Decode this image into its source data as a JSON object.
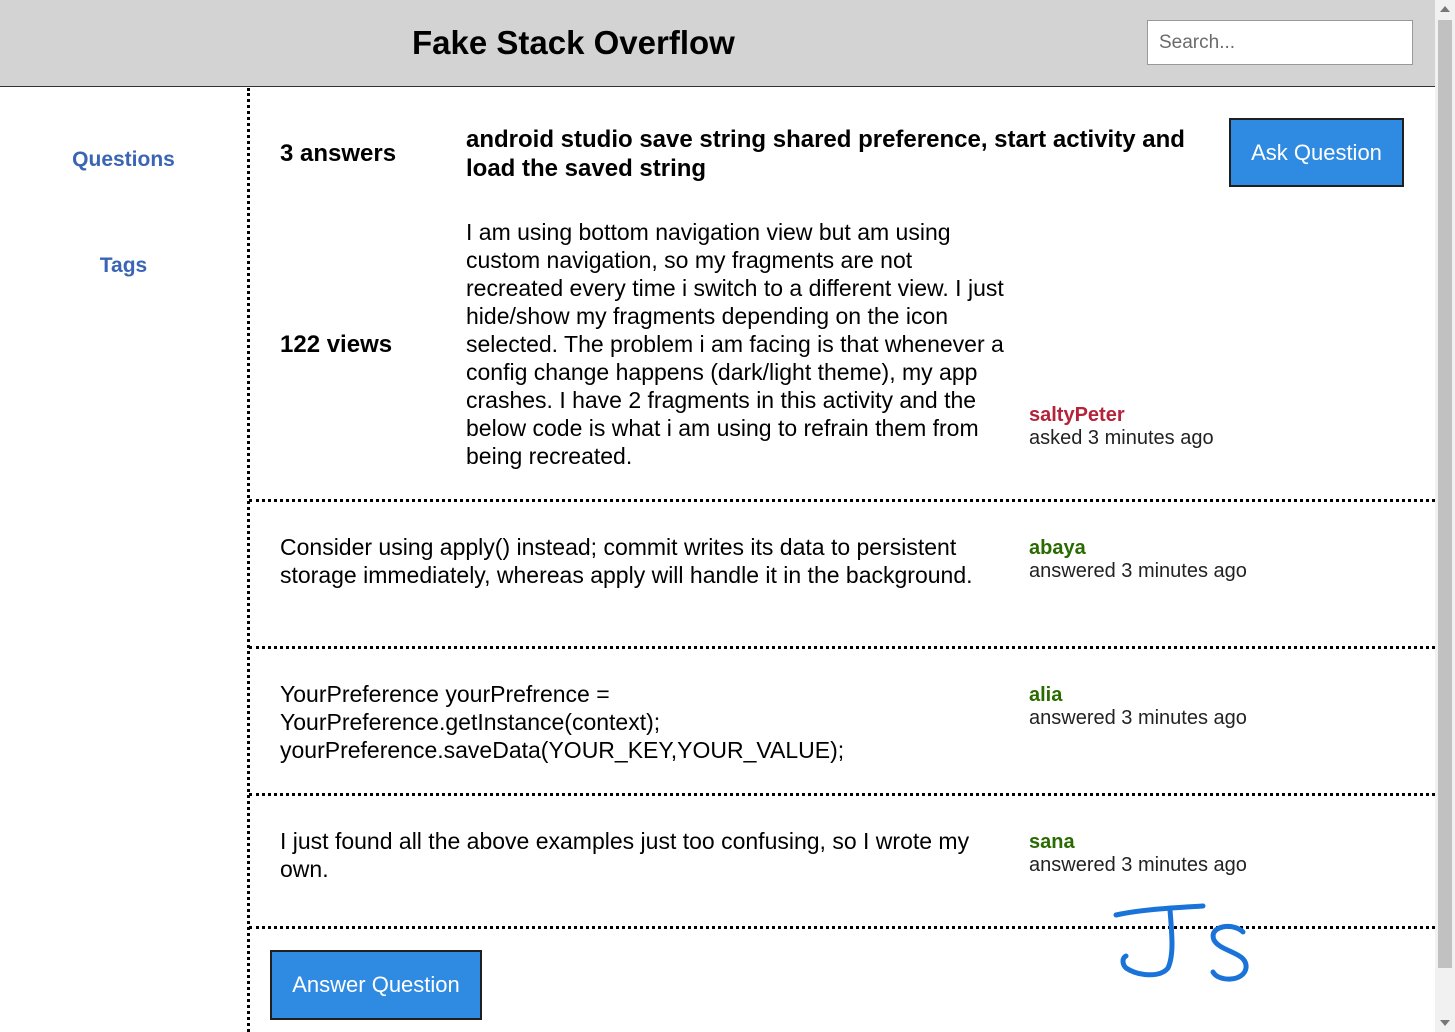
{
  "header": {
    "title": "Fake Stack Overflow",
    "search_placeholder": "Search..."
  },
  "sidebar": {
    "items": [
      {
        "label": "Questions"
      },
      {
        "label": "Tags"
      }
    ]
  },
  "question": {
    "answers_count": "3 answers",
    "views": "122 views",
    "title": "android studio save string shared preference, start activity and load the saved string",
    "text": "I am using bottom navigation view but am using custom navigation, so my fragments are not recreated every time i switch to a different view. I just hide/show my fragments depending on the icon selected. The problem i am facing is that whenever a config change happens (dark/light theme), my app crashes. I have 2 fragments in this activity and the below code is what i am using to refrain them from being recreated.",
    "asked_by": "saltyPeter",
    "asked_time": "asked 3 minutes ago",
    "ask_button_label": "Ask Question"
  },
  "answers": [
    {
      "text": "Consider using apply() instead; commit writes its data to persistent storage immediately, whereas apply will handle it in the background.",
      "user": "abaya",
      "time": "answered 3 minutes ago"
    },
    {
      "text": "YourPreference yourPrefrence = YourPreference.getInstance(context); yourPreference.saveData(YOUR_KEY,YOUR_VALUE);",
      "user": "alia",
      "time": "answered 3 minutes ago"
    },
    {
      "text": "I just found all the above examples just too confusing, so I wrote my own.",
      "user": "sana",
      "time": "answered 3 minutes ago"
    }
  ],
  "answer_button_label": "Answer Question",
  "colors": {
    "header_bg": "#d3d3d3",
    "nav_link": "#3a64b5",
    "button_bg": "#2f8be2",
    "asker_name": "#b5233a",
    "answerer_name": "#2a6b00",
    "signature_ink": "#1a73d9"
  },
  "signature": "JS"
}
